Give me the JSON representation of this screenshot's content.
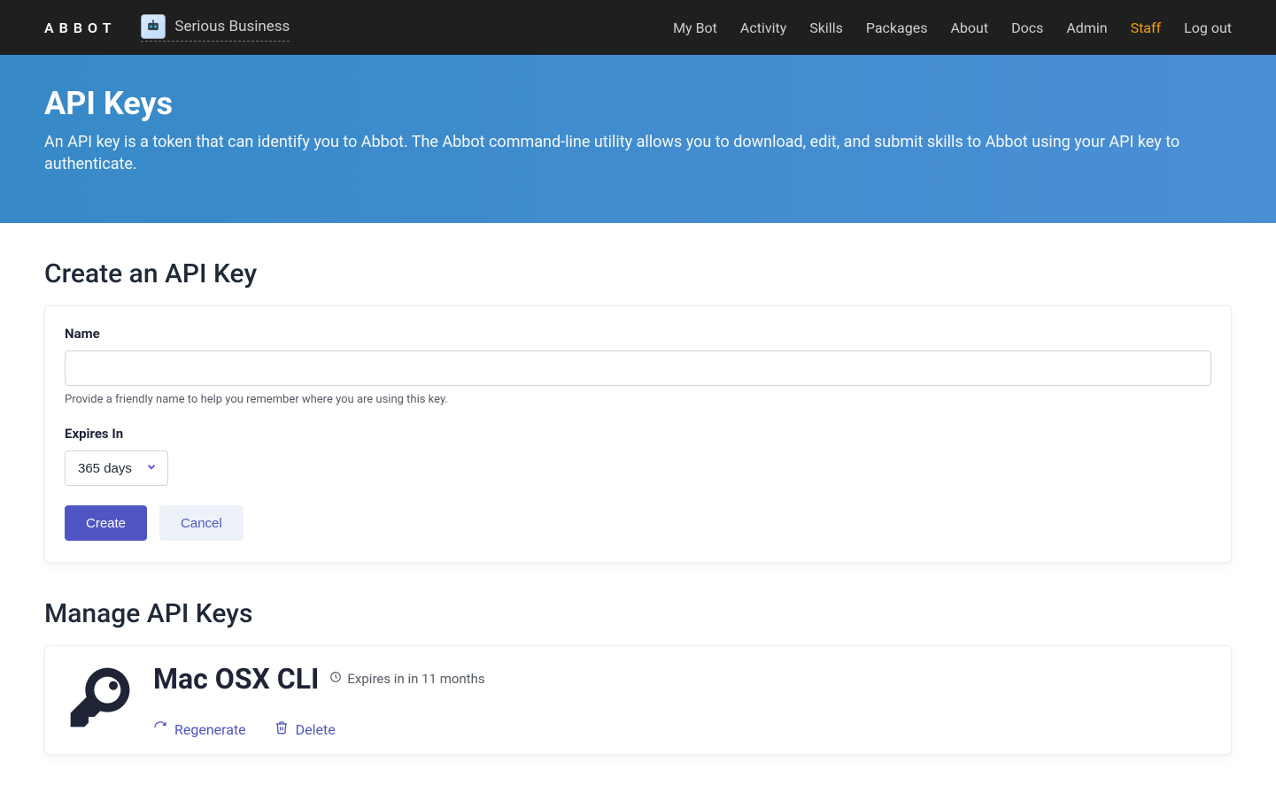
{
  "nav": {
    "brand": "ABBOT",
    "org_name": "Serious Business",
    "links": [
      {
        "id": "mybot",
        "label": "My Bot",
        "active": false
      },
      {
        "id": "activity",
        "label": "Activity",
        "active": false
      },
      {
        "id": "skills",
        "label": "Skills",
        "active": false
      },
      {
        "id": "packages",
        "label": "Packages",
        "active": false
      },
      {
        "id": "about",
        "label": "About",
        "active": false
      },
      {
        "id": "docs",
        "label": "Docs",
        "active": false
      },
      {
        "id": "admin",
        "label": "Admin",
        "active": false
      },
      {
        "id": "staff",
        "label": "Staff",
        "active": true
      },
      {
        "id": "logout",
        "label": "Log out",
        "active": false
      }
    ]
  },
  "hero": {
    "title": "API Keys",
    "subtitle": "An API key is a token that can identify you to Abbot. The Abbot command-line utility allows you to download, edit, and submit skills to Abbot using your API key to authenticate."
  },
  "create": {
    "section_title": "Create an API Key",
    "name_label": "Name",
    "name_value": "",
    "name_help": "Provide a friendly name to help you remember where you are using this key.",
    "expires_label": "Expires In",
    "expires_value": "365 days",
    "create_button": "Create",
    "cancel_button": "Cancel"
  },
  "manage": {
    "section_title": "Manage API Keys",
    "keys": [
      {
        "name": "Mac OSX CLI",
        "expires_text": "Expires in in 11 months",
        "regenerate_label": "Regenerate",
        "delete_label": "Delete"
      }
    ]
  }
}
